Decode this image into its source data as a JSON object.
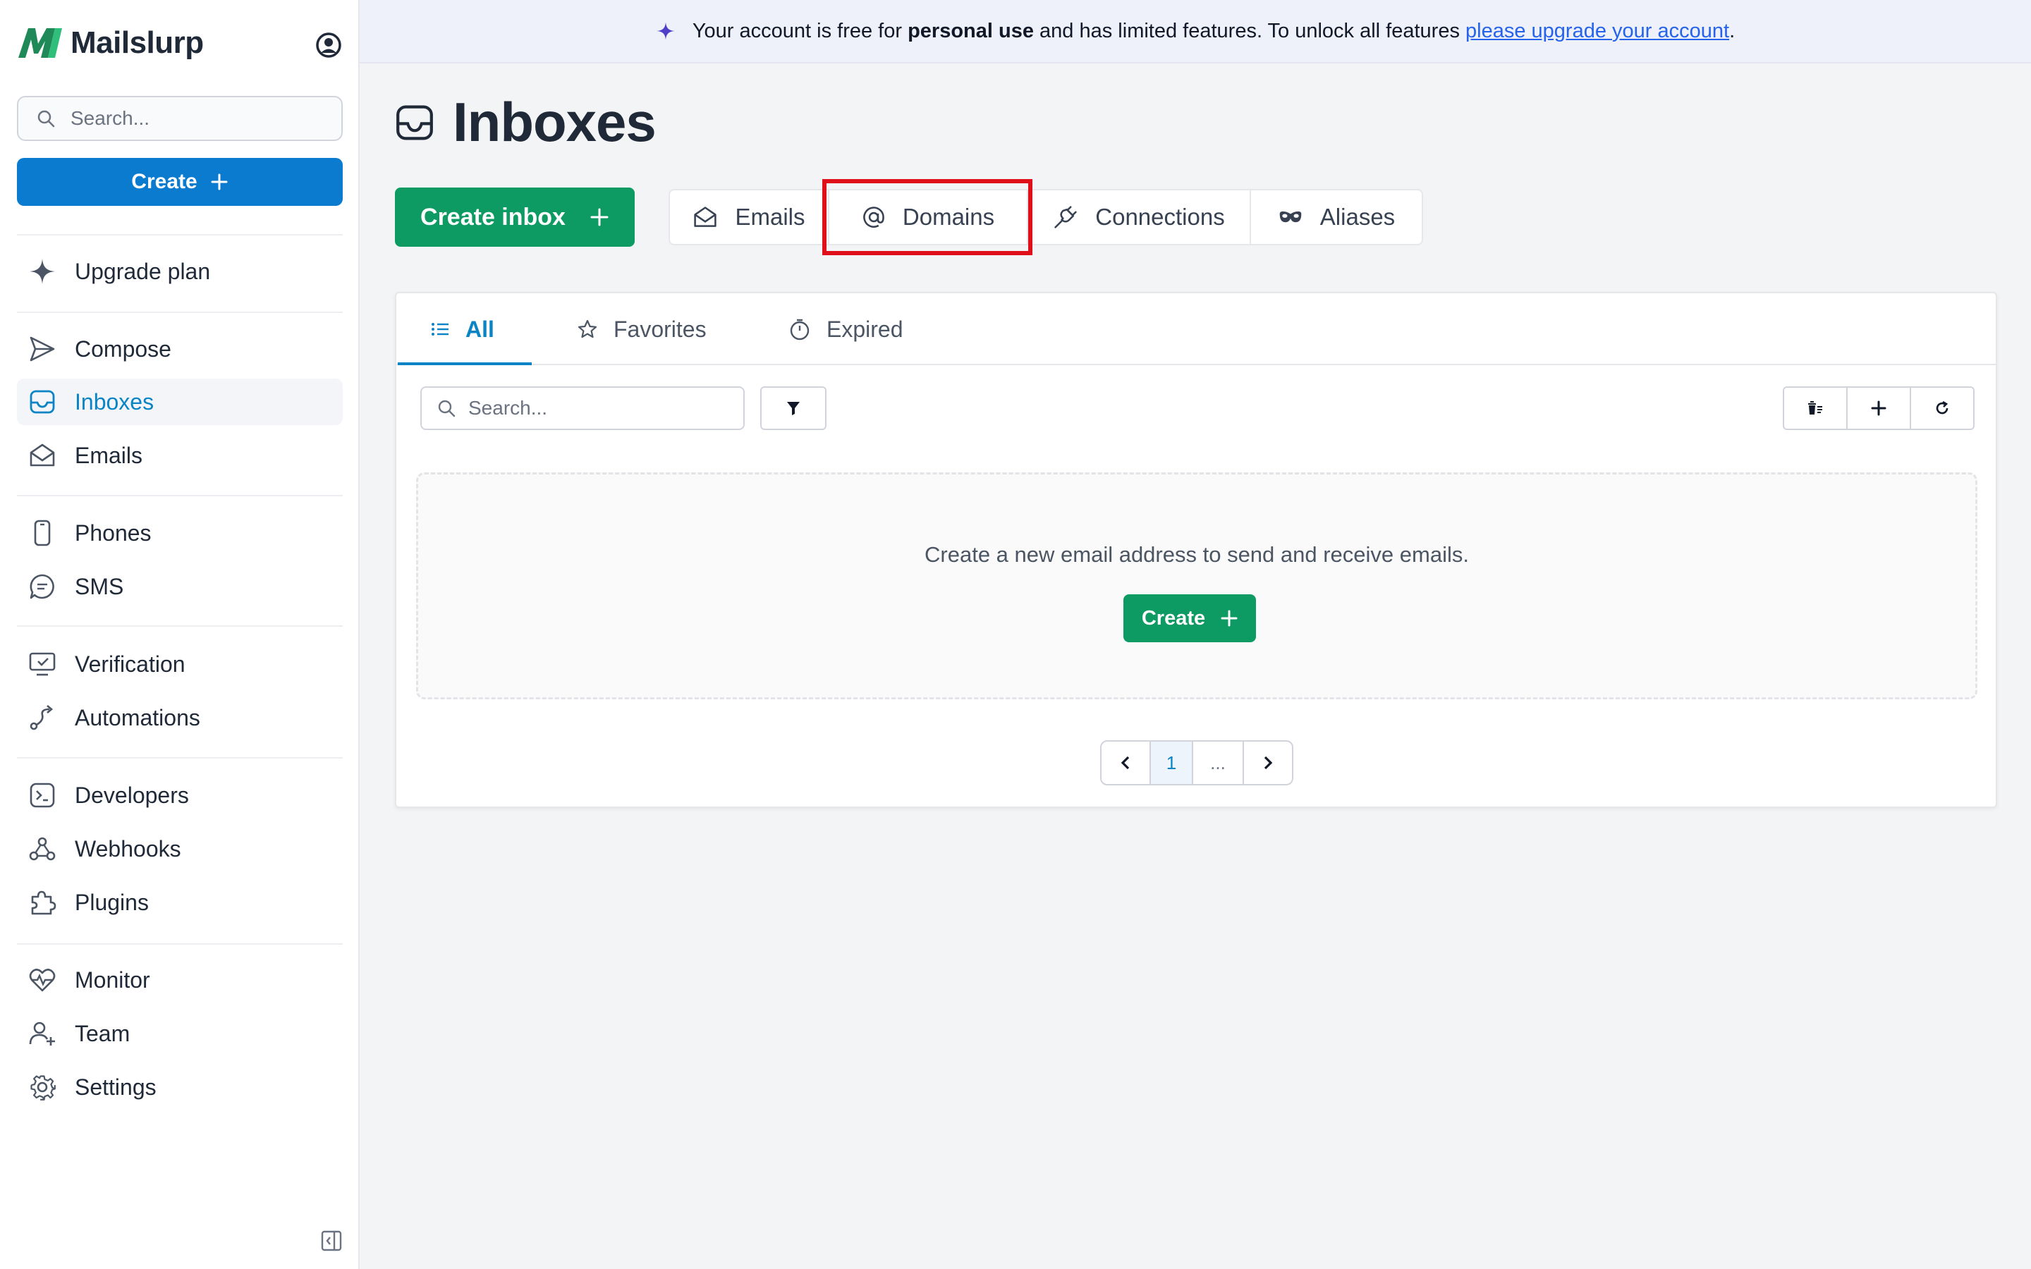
{
  "brand": {
    "name": "Mailslurp"
  },
  "sidebar": {
    "search_placeholder": "Search...",
    "create_label": "Create",
    "upgrade_label": "Upgrade plan",
    "items": [
      {
        "label": "Compose",
        "icon": "send-icon"
      },
      {
        "label": "Inboxes",
        "icon": "inbox-icon",
        "active": true
      },
      {
        "label": "Emails",
        "icon": "envelope-open-icon"
      },
      {
        "label": "Phones",
        "icon": "phone-icon"
      },
      {
        "label": "SMS",
        "icon": "chat-bubble-icon"
      },
      {
        "label": "Verification",
        "icon": "monitor-check-icon"
      },
      {
        "label": "Automations",
        "icon": "route-icon"
      },
      {
        "label": "Developers",
        "icon": "terminal-icon"
      },
      {
        "label": "Webhooks",
        "icon": "webhook-icon"
      },
      {
        "label": "Plugins",
        "icon": "puzzle-icon"
      },
      {
        "label": "Monitor",
        "icon": "heart-pulse-icon"
      },
      {
        "label": "Team",
        "icon": "users-plus-icon"
      },
      {
        "label": "Settings",
        "icon": "gear-icon"
      }
    ]
  },
  "banner": {
    "text_prefix": "Your account is free for",
    "text_bold": "personal use",
    "text_middle": "and has limited features. To unlock all features",
    "link_text": "please upgrade your account",
    "text_suffix": "."
  },
  "page": {
    "title": "Inboxes",
    "create_inbox_label": "Create inbox",
    "segments": [
      "Emails",
      "Domains",
      "Connections",
      "Aliases"
    ],
    "tabs": [
      "All",
      "Favorites",
      "Expired"
    ],
    "search_placeholder": "Search...",
    "empty_text": "Create a new email address to send and receive emails.",
    "empty_create_label": "Create",
    "pagination": {
      "current": "1",
      "ellipsis": "..."
    }
  },
  "colors": {
    "primary_green": "#0e9a63",
    "primary_blue": "#0b7bd0",
    "active_blue": "#0b84c6",
    "highlight_red": "#e0101a",
    "banner_bg": "#eef0fa"
  }
}
